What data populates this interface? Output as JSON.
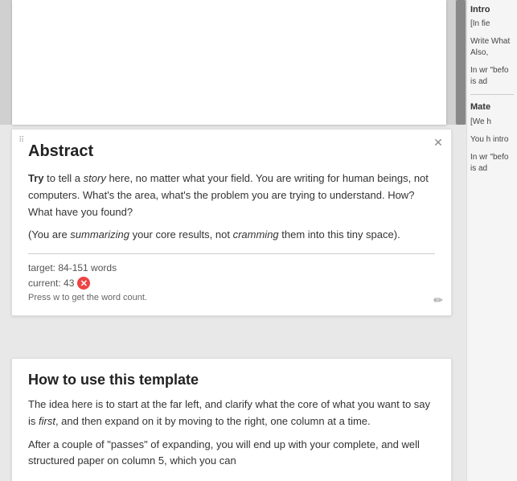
{
  "left": {
    "abstract": {
      "title": "Abstract",
      "paragraph1": "Try to tell a story here, no matter what your field. You are writing for human beings, not computers. What's the area, what's the problem you are trying to understand. How? What have you found?",
      "paragraph1_try": "Try",
      "paragraph1_story": "story",
      "paragraph2_prefix": "(You are ",
      "paragraph2_summarizing": "summarizing",
      "paragraph2_middle": " your core results, not ",
      "paragraph2_cramming": "cramming",
      "paragraph2_suffix": " them into this tiny space).",
      "target_label": "target: 84-151 words",
      "current_label": "current: 43",
      "hint": "Press w to get the word count."
    },
    "howto": {
      "title": "How to use this template",
      "paragraph1": "The idea here is to start at the far left, and clarify what the core of what you want to say is first, and then expand on it by moving to the right, one column at a time.",
      "paragraph1_first": "first",
      "paragraph2": "After a couple of \"passes\" of expanding, you will end up with your complete, and well structured paper on column 5, which you can"
    }
  },
  "right": {
    "intro_title": "Intro",
    "intro_text": "[In fie",
    "intro_body": "Write What Also,",
    "intro_extra": "In wr \"befo is ad",
    "materials_title": "Mate",
    "materials_text": "[We h",
    "materials_body": "You h intro",
    "materials_extra": "In wr \"befo is ad"
  },
  "icons": {
    "close": "✕",
    "drag": "⠿",
    "error": "✕",
    "edit": "✏"
  }
}
